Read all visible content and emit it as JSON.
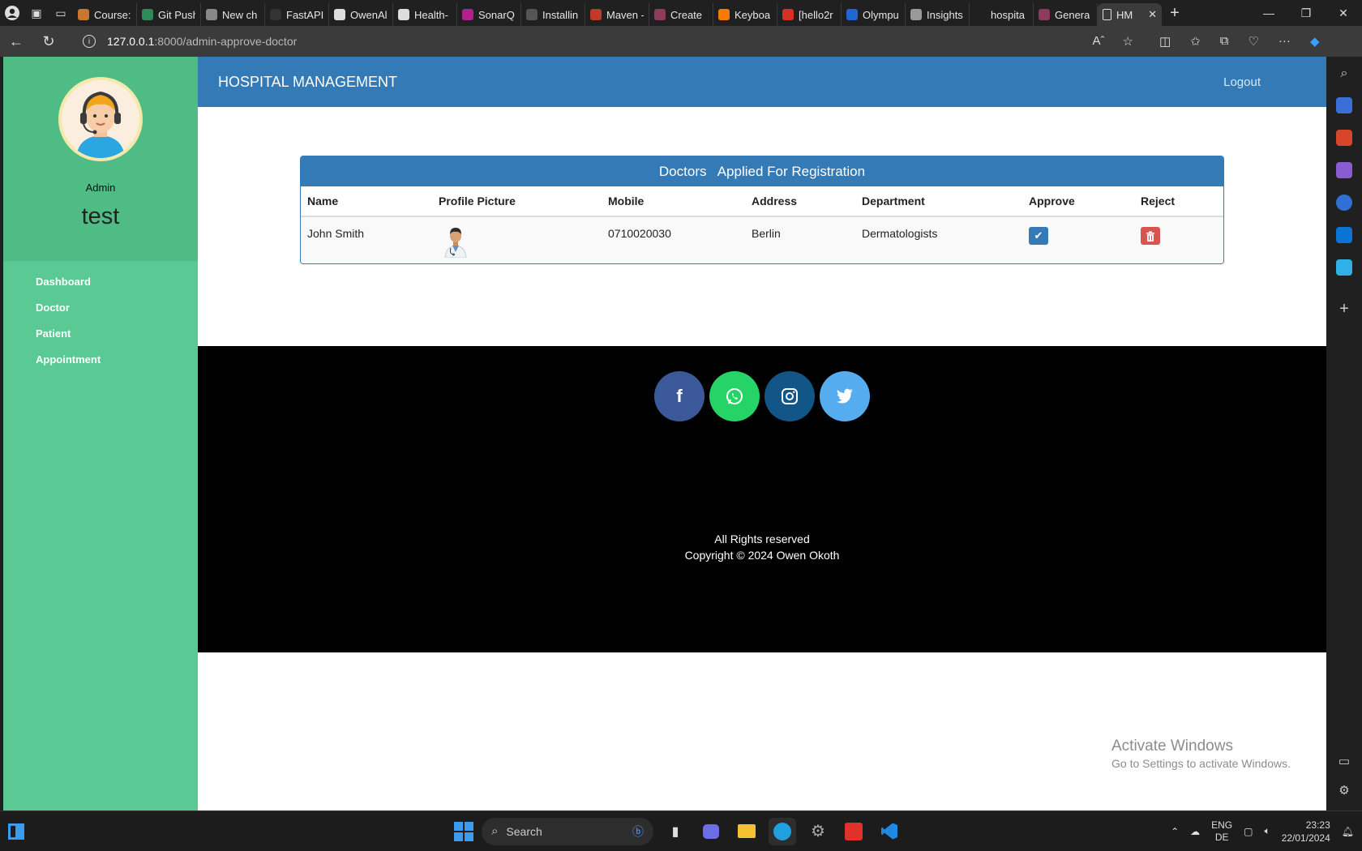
{
  "browser": {
    "tabs": [
      {
        "title": "Course:",
        "color": "#c9772e"
      },
      {
        "title": "Git Push",
        "color": "#2e8b57"
      },
      {
        "title": "New ch",
        "color": "#888888"
      },
      {
        "title": "FastAPI",
        "color": "#333333"
      },
      {
        "title": "OwenAl",
        "color": "#dddddd"
      },
      {
        "title": "Health-",
        "color": "#dddddd"
      },
      {
        "title": "SonarQ",
        "color": "#b0208f"
      },
      {
        "title": "Installin",
        "color": "#555555"
      },
      {
        "title": "Maven -",
        "color": "#c0392b"
      },
      {
        "title": "Create",
        "color": "#8e3b5d"
      },
      {
        "title": "Keyboa",
        "color": "#f57c00"
      },
      {
        "title": "[hello2r",
        "color": "#d93025"
      },
      {
        "title": "Olympu",
        "color": "#1e66d0"
      },
      {
        "title": "Insights",
        "color": "#999999"
      },
      {
        "title": "hospita",
        "color": "#202020"
      },
      {
        "title": "Genera",
        "color": "#8e3b5d"
      }
    ],
    "active_tab": {
      "title": "HM"
    },
    "url_host": "127.0.0.1",
    "url_path": ":8000/admin-approve-doctor"
  },
  "sidebar": {
    "role": "Admin",
    "username": "test",
    "items": [
      {
        "label": "Dashboard"
      },
      {
        "label": "Doctor"
      },
      {
        "label": "Patient"
      },
      {
        "label": "Appointment"
      }
    ]
  },
  "header": {
    "brand": "HOSPITAL MANAGEMENT",
    "logout": "Logout"
  },
  "panel": {
    "title": "Doctors   Applied For Registration",
    "columns": [
      "Name",
      "Profile Picture",
      "Mobile",
      "Address",
      "Department",
      "Approve",
      "Reject"
    ],
    "rows": [
      {
        "name": "John Smith",
        "mobile": "0710020030",
        "address": "Berlin",
        "department": "Dermatologists"
      }
    ]
  },
  "footer": {
    "line1": "All Rights reserved",
    "line2": "Copyright © 2024 Owen Okoth",
    "social": [
      "facebook",
      "whatsapp",
      "instagram",
      "twitter"
    ]
  },
  "watermark": {
    "title": "Activate Windows",
    "subtitle": "Go to Settings to activate Windows."
  },
  "taskbar": {
    "search_placeholder": "Search",
    "lang_top": "ENG",
    "lang_bottom": "DE",
    "time": "23:23",
    "date": "22/01/2024"
  },
  "colors": {
    "sidebar": "#5ac994",
    "header": "#337ab7",
    "approve": "#337ab7",
    "reject": "#d9534f"
  }
}
